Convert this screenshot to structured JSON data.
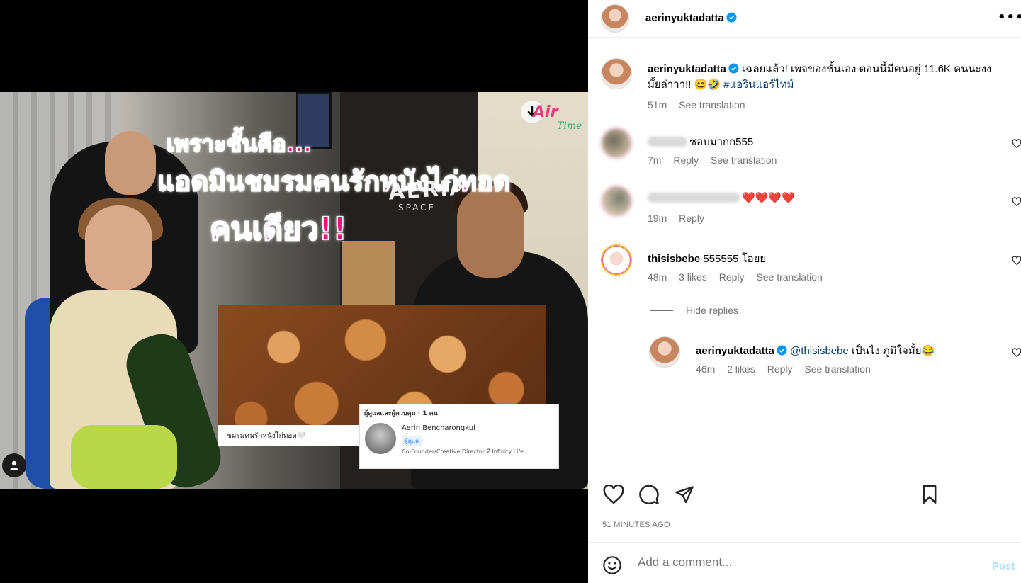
{
  "video": {
    "caption_line1": "เพราะชั้นคือ...",
    "caption_line2": "แอดมินชมรมคนรักหนังไก่ทอด",
    "caption_line3": "คนเดียว!!",
    "watermark_air": "Air",
    "watermark_time": "Time",
    "wall_sign": "AERIAL",
    "wall_sign_sub": "SPACE",
    "food_label": "ชมรมคนรักหนังไก่ทอด🤍",
    "fb_card": {
      "header": "ผู้ดูแลและผู้ควบคุม · 1 คน",
      "name": "Aerin Bencharongkul",
      "badge": "ผู้ดูแล",
      "role": "Co-Founder/Creative Director ที่ Infinity Life"
    }
  },
  "header": {
    "username": "aerinyuktadatta",
    "more_label": "•••"
  },
  "caption": {
    "username": "aerinyuktadatta",
    "text": "เฉลยแล้ว! เพจของชั้นเอง ตอนนี้มีคนอยู่ 11.6K คนนะงงมั้ยล่าาา!! 😄🤣",
    "hashtag": "#แอรินแอร์ไทม์",
    "time": "51m",
    "see_translation": "See translation"
  },
  "comments": [
    {
      "username": "",
      "text": "ชอบมากก555",
      "time": "7m",
      "reply": "Reply",
      "see_translation": "See translation"
    },
    {
      "username": "",
      "text": "❤️❤️❤️❤️",
      "time": "19m",
      "reply": "Reply"
    },
    {
      "username": "thisisbebe",
      "text": "555555 โอยย",
      "time": "48m",
      "likes": "3 likes",
      "reply": "Reply",
      "see_translation": "See translation"
    }
  ],
  "hide_replies": "Hide replies",
  "reply": {
    "username": "aerinyuktadatta",
    "mention": "@thisisbebe",
    "text": " เป็นไง ภูมิใจมั้ย😂",
    "time": "46m",
    "likes": "2 likes",
    "reply": "Reply",
    "see_translation": "See translation"
  },
  "actions": {
    "time_ago": "51 MINUTES AGO"
  },
  "add_comment": {
    "placeholder": "Add a comment...",
    "post": "Post"
  },
  "colors": {
    "accent": "#0095f6",
    "post_disabled": "#b2dffc",
    "secondary_text": "#737373",
    "link": "#00376b",
    "caption_pink": "#e8157e"
  }
}
